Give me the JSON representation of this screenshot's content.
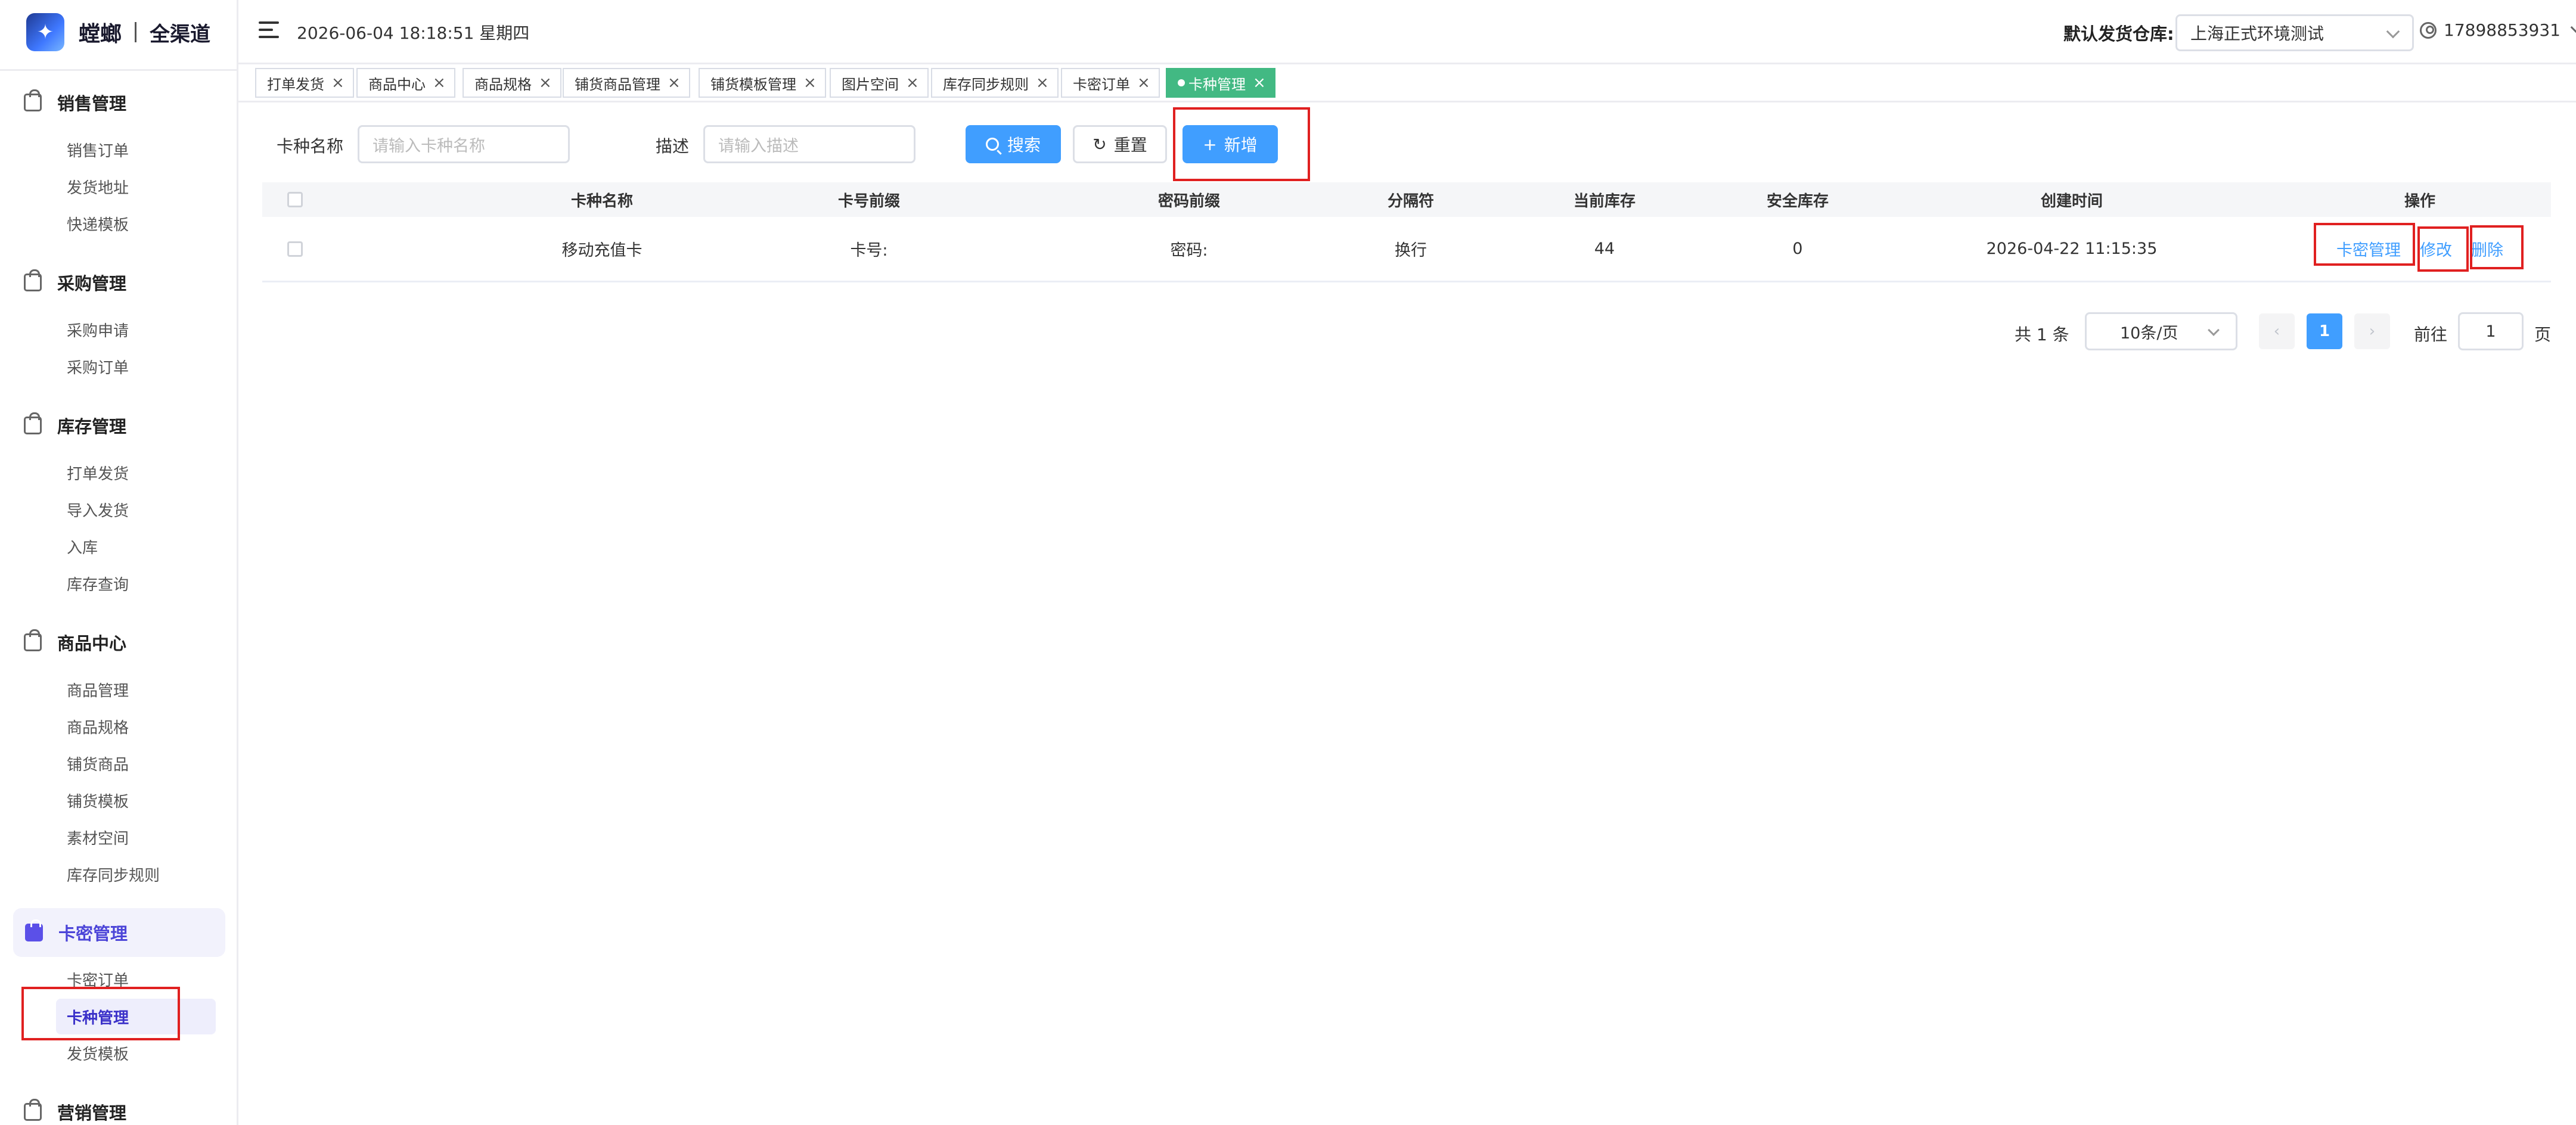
{
  "brand": {
    "name": "螳螂",
    "sub": "全渠道"
  },
  "header": {
    "datetime": "2026-06-04 18:18:51 星期四",
    "warehouse_label": "默认发货仓库:",
    "warehouse_value": "上海正式环境测试",
    "user": "17898853931"
  },
  "sidebar": {
    "groups": [
      {
        "title": "销售管理",
        "items": [
          "销售订单",
          "发货地址",
          "快递模板"
        ]
      },
      {
        "title": "采购管理",
        "items": [
          "采购申请",
          "采购订单"
        ]
      },
      {
        "title": "库存管理",
        "items": [
          "打单发货",
          "导入发货",
          "入库",
          "库存查询"
        ]
      },
      {
        "title": "商品中心",
        "items": [
          "商品管理",
          "商品规格",
          "铺货商品",
          "铺货模板",
          "素材空间",
          "库存同步规则"
        ]
      },
      {
        "title": "卡密管理",
        "items": [
          "卡密订单",
          "卡种管理",
          "发货模板"
        ]
      },
      {
        "title": "营销管理",
        "items": []
      }
    ]
  },
  "tabs": [
    "打单发货",
    "商品中心",
    "商品规格",
    "铺货商品管理",
    "铺货模板管理",
    "图片空间",
    "库存同步规则",
    "卡密订单",
    "卡种管理"
  ],
  "filters": {
    "name_label": "卡种名称",
    "name_placeholder": "请输入卡种名称",
    "desc_label": "描述",
    "desc_placeholder": "请输入描述",
    "search_label": "搜索",
    "reset_label": "重置",
    "add_label": "新增"
  },
  "table": {
    "columns": [
      "卡种名称",
      "卡号前缀",
      "密码前缀",
      "分隔符",
      "当前库存",
      "安全库存",
      "创建时间",
      "操作"
    ],
    "rows": [
      {
        "name": "移动充值卡",
        "card_prefix": "卡号:",
        "pwd_prefix": "密码:",
        "separator": "换行",
        "stock": "44",
        "safe_stock": "0",
        "created": "2026-04-22 11:15:35"
      }
    ],
    "actions": [
      "卡密管理",
      "修改",
      "删除"
    ]
  },
  "pagination": {
    "total": "共 1 条",
    "page_size": "10条/页",
    "current_page": "1",
    "goto_label": "前往",
    "goto_value": "1",
    "page_unit": "页"
  },
  "colors": {
    "primary": "#409eff",
    "active_tab": "#42b983",
    "sidebar_accent": "#5b50e8",
    "highlight": "#e02020"
  }
}
